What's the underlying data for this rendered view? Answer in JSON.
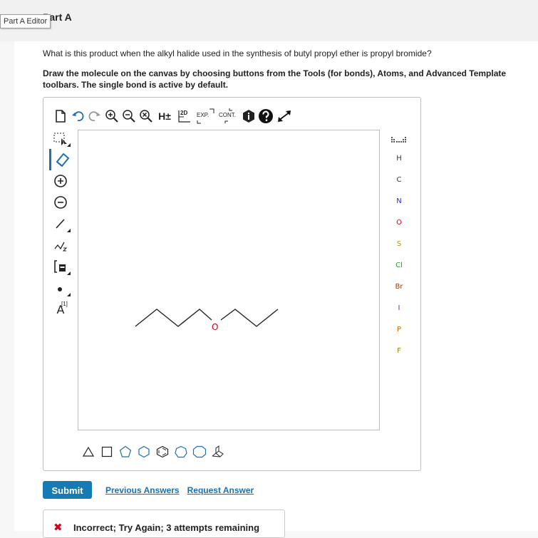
{
  "header": {
    "part_title": "Part A",
    "tooltip": "Part A Editor"
  },
  "question": {
    "text": "What is this product when the alkyl halide used in the synthesis of butyl propyl ether is propyl bromide?",
    "instruction": "Draw the molecule on the canvas by choosing buttons from the Tools (for bonds), Atoms, and Advanced Template toolbars. The single bond is active by default."
  },
  "toolbar": {
    "hplus": "H±",
    "label_2d": "2D",
    "exp": "EXP.",
    "cont": "CONT."
  },
  "left_tools": {
    "charge_label": "A",
    "charge_sup": "[1]"
  },
  "atoms": [
    "H",
    "C",
    "N",
    "O",
    "S",
    "Cl",
    "Br",
    "I",
    "P",
    "F"
  ],
  "atom_colors": {
    "H": "#333333",
    "C": "#333333",
    "N": "#2a2acc",
    "O": "#d0021b",
    "S": "#b09000",
    "Cl": "#1f9e1f",
    "Br": "#9a3d10",
    "I": "#7a2a9a",
    "P": "#d07000",
    "F": "#8a8a00"
  },
  "molecule": {
    "oxygen_label": "O"
  },
  "actions": {
    "submit": "Submit",
    "previous": "Previous Answers",
    "request": "Request Answer"
  },
  "feedback": {
    "text": "Incorrect; Try Again; 3 attempts remaining"
  },
  "colors": {
    "accent": "#167ab4",
    "link": "#1a6fb4",
    "error": "#d0021b"
  }
}
